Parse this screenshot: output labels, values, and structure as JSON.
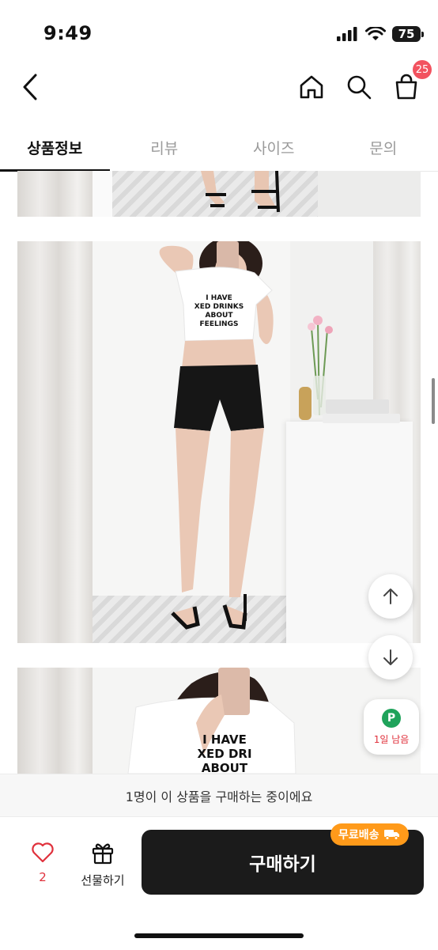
{
  "status": {
    "time": "9:49",
    "battery": "75"
  },
  "header": {
    "cart_count": "25"
  },
  "tabs": [
    {
      "label": "상품정보",
      "active": true
    },
    {
      "label": "리뷰",
      "active": false
    },
    {
      "label": "사이즈",
      "active": false
    },
    {
      "label": "문의",
      "active": false
    }
  ],
  "photos": [
    {
      "shirt_text": ""
    },
    {
      "shirt_text": "I HAVE / MIXED DRINKS / ABOUT / FEELINGS"
    },
    {
      "shirt_text": ""
    }
  ],
  "side": {
    "point_label": "P",
    "point_text": "1일 남음"
  },
  "notice": "1명이 이 상품을 구매하는 중이에요",
  "bottom": {
    "like_count": "2",
    "gift_label": "선물하기",
    "buy_label": "구매하기",
    "free_ship_label": "무료배송"
  },
  "colors": {
    "accent_red": "#f2525f",
    "buy_bg": "#1b1b1b",
    "free_ship": "#ff9a1a",
    "point_green": "#1fa35b"
  }
}
